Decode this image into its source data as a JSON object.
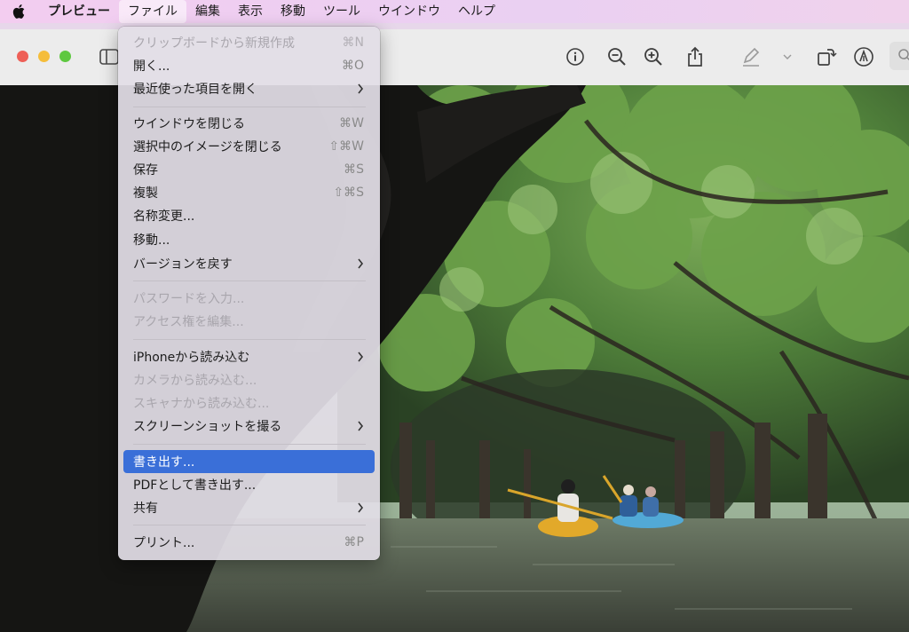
{
  "menubar": {
    "items": [
      "プレビュー",
      "ファイル",
      "編集",
      "表示",
      "移動",
      "ツール",
      "ウインドウ",
      "ヘルプ"
    ]
  },
  "file_menu": {
    "items": [
      {
        "label": "クリップボードから新規作成",
        "shortcut": "⌘N",
        "disabled": true
      },
      {
        "label": "開く...",
        "shortcut": "⌘O"
      },
      {
        "label": "最近使った項目を開く",
        "submenu": true
      },
      {
        "label": "ウインドウを閉じる",
        "shortcut": "⌘W"
      },
      {
        "label": "選択中のイメージを閉じる",
        "shortcut": "⇧⌘W"
      },
      {
        "label": "保存",
        "shortcut": "⌘S"
      },
      {
        "label": "複製",
        "shortcut": "⇧⌘S"
      },
      {
        "label": "名称変更..."
      },
      {
        "label": "移動..."
      },
      {
        "label": "バージョンを戻す",
        "submenu": true
      },
      {
        "label": "パスワードを入力...",
        "disabled": true
      },
      {
        "label": "アクセス権を編集...",
        "disabled": true
      },
      {
        "label": "iPhoneから読み込む",
        "submenu": true
      },
      {
        "label": "カメラから読み込む...",
        "disabled": true
      },
      {
        "label": "スキャナから読み込む...",
        "disabled": true
      },
      {
        "label": "スクリーンショットを撮る",
        "submenu": true
      },
      {
        "label": "書き出す...",
        "selected": true
      },
      {
        "label": "PDFとして書き出す..."
      },
      {
        "label": "共有",
        "submenu": true
      },
      {
        "label": "プリント...",
        "shortcut": "⌘P"
      }
    ]
  },
  "colors": {
    "selection": "#3a6fd8",
    "traffic_close": "#ee5f57",
    "traffic_min": "#f5bd3a",
    "traffic_max": "#5ec840"
  },
  "photo": {
    "description_icon": "mangrove-kayak-photo"
  }
}
